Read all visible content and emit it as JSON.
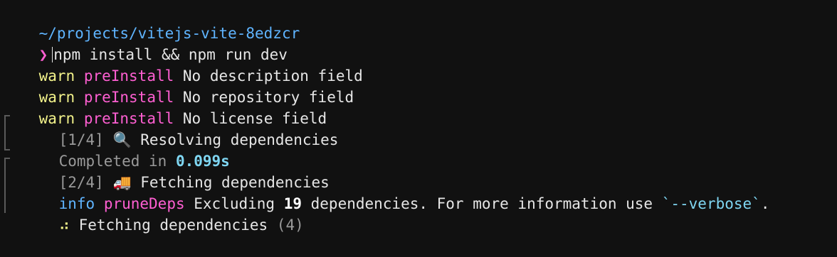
{
  "cwd": "~/projects/vitejs-vite-8edzcr",
  "prompt_symbol": "❯",
  "command": "npm install && npm run dev",
  "warnings": [
    {
      "level": "warn",
      "tag": "preInstall",
      "message": "No description field"
    },
    {
      "level": "warn",
      "tag": "preInstall",
      "message": "No repository field"
    },
    {
      "level": "warn",
      "tag": "preInstall",
      "message": "No license field"
    }
  ],
  "step1": {
    "counter": "[1/4]",
    "icon": "🔍",
    "icon_name": "magnifier-icon",
    "label": "Resolving dependencies",
    "completed_prefix": "Completed in ",
    "completed_time": "0.099s"
  },
  "step2": {
    "counter": "[2/4]",
    "icon": "🚚",
    "icon_name": "delivery-truck-icon",
    "label": "Fetching dependencies",
    "info_level": "info",
    "info_tag": "pruneDeps",
    "info_text1": "Excluding ",
    "info_count": "19",
    "info_text2": " dependencies. For more information use ",
    "info_code": "`--verbose`",
    "info_text3": ".",
    "progress_spinner": "⠴",
    "progress_label": "Fetching dependencies",
    "progress_count": "(4)"
  },
  "colors": {
    "background": "#111111",
    "cwd": "#5fb4ff",
    "prompt": "#ff5fd2",
    "warn": "#f2f28a",
    "tag": "#ff5fd2",
    "info": "#5fb4ff",
    "number": "#7fd6f2"
  }
}
